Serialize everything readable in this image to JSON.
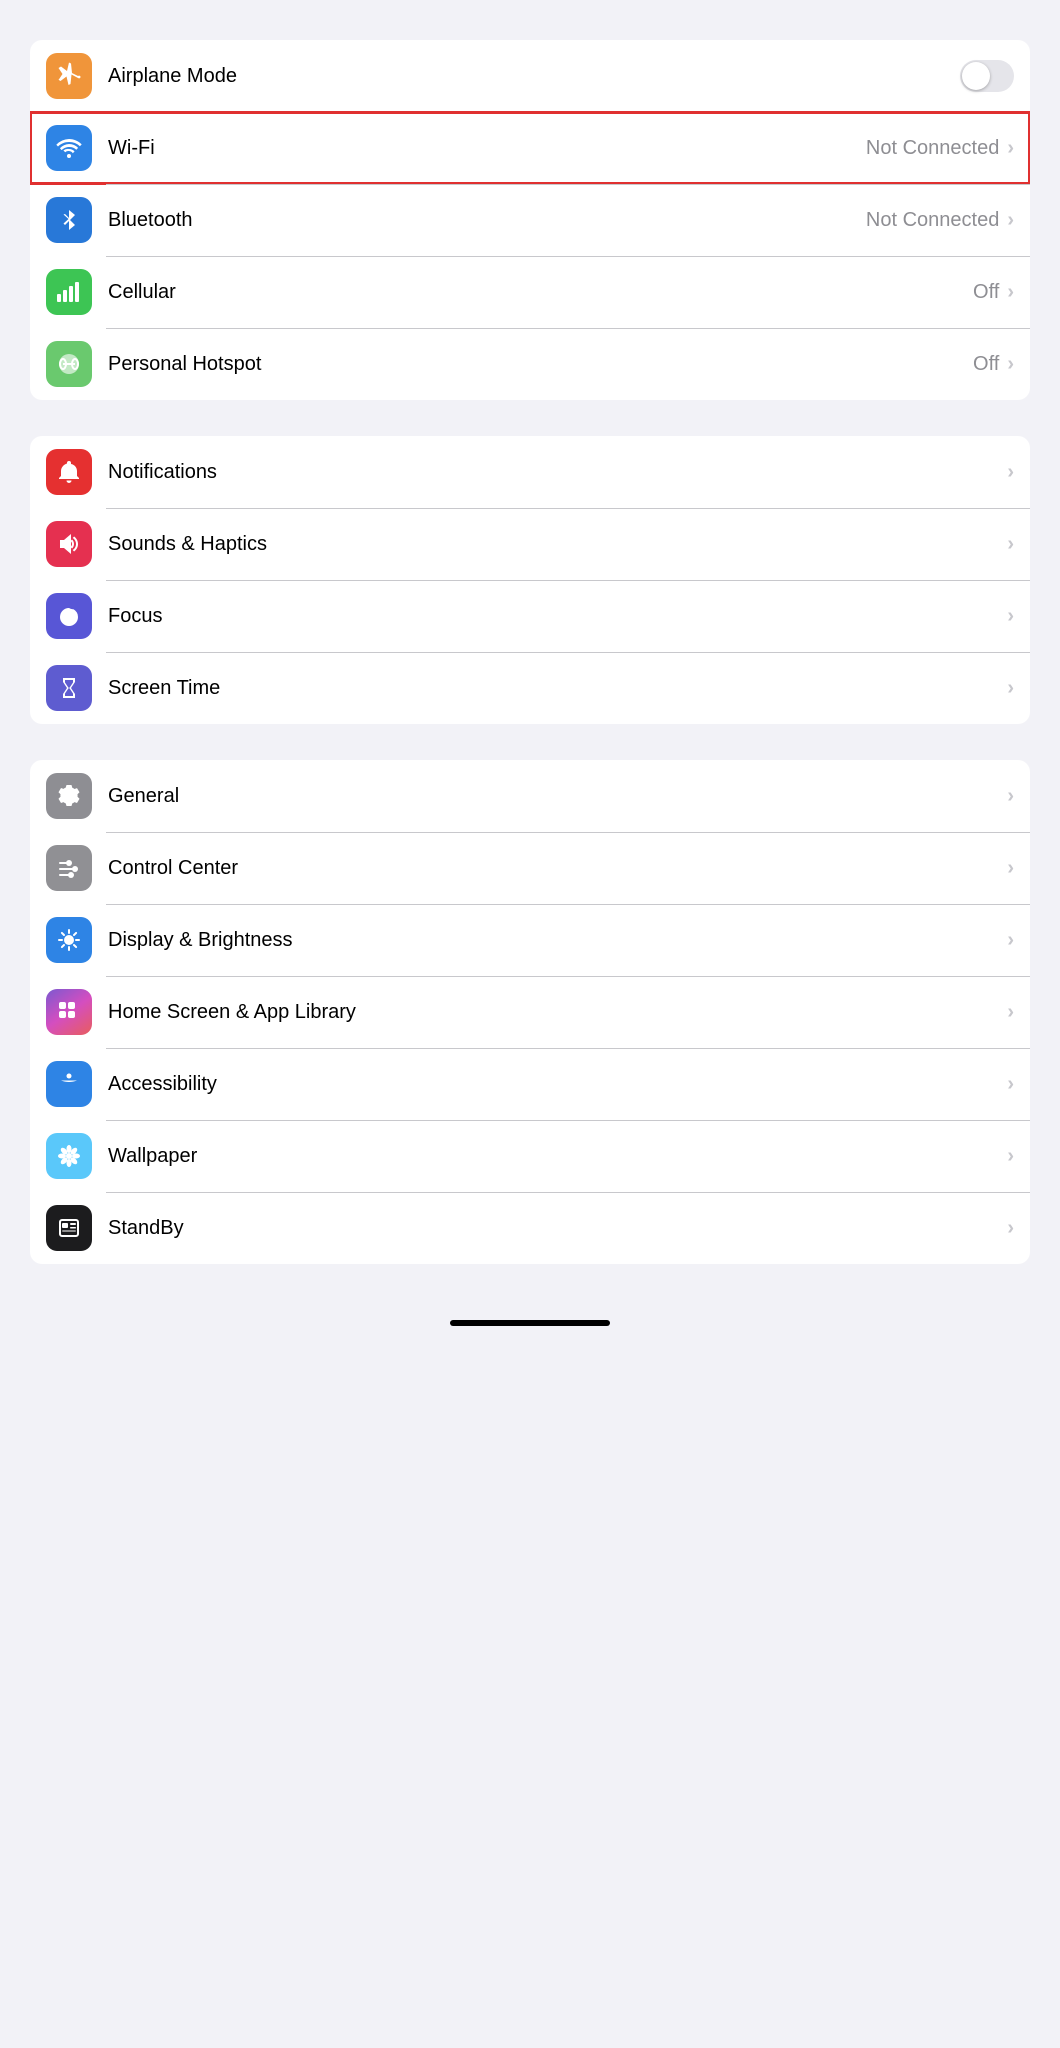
{
  "groups": [
    {
      "id": "connectivity",
      "rows": [
        {
          "id": "airplane-mode",
          "label": "Airplane Mode",
          "icon": "airplane-icon",
          "iconBg": "bg-orange",
          "type": "toggle",
          "toggleOn": false,
          "selected": false
        },
        {
          "id": "wifi",
          "label": "Wi-Fi",
          "icon": "wifi-icon",
          "iconBg": "bg-blue",
          "type": "value-chevron",
          "value": "Not Connected",
          "selected": true
        },
        {
          "id": "bluetooth",
          "label": "Bluetooth",
          "icon": "bluetooth-icon",
          "iconBg": "bg-blue-dark",
          "type": "value-chevron",
          "value": "Not Connected",
          "selected": false
        },
        {
          "id": "cellular",
          "label": "Cellular",
          "icon": "cellular-icon",
          "iconBg": "bg-green",
          "type": "value-chevron",
          "value": "Off",
          "selected": false
        },
        {
          "id": "personal-hotspot",
          "label": "Personal Hotspot",
          "icon": "hotspot-icon",
          "iconBg": "bg-green-light",
          "type": "value-chevron",
          "value": "Off",
          "selected": false
        }
      ]
    },
    {
      "id": "notifications",
      "rows": [
        {
          "id": "notifications",
          "label": "Notifications",
          "icon": "bell-icon",
          "iconBg": "bg-red",
          "type": "chevron",
          "selected": false
        },
        {
          "id": "sounds-haptics",
          "label": "Sounds & Haptics",
          "icon": "sound-icon",
          "iconBg": "bg-red-pink",
          "type": "chevron",
          "selected": false
        },
        {
          "id": "focus",
          "label": "Focus",
          "icon": "moon-icon",
          "iconBg": "bg-purple",
          "type": "chevron",
          "selected": false
        },
        {
          "id": "screen-time",
          "label": "Screen Time",
          "icon": "hourglass-icon",
          "iconBg": "bg-purple-dark",
          "type": "chevron",
          "selected": false
        }
      ]
    },
    {
      "id": "display",
      "rows": [
        {
          "id": "general",
          "label": "General",
          "icon": "gear-icon",
          "iconBg": "bg-gray",
          "type": "chevron",
          "selected": false
        },
        {
          "id": "control-center",
          "label": "Control Center",
          "icon": "sliders-icon",
          "iconBg": "bg-gray-med",
          "type": "chevron",
          "selected": false
        },
        {
          "id": "display-brightness",
          "label": "Display & Brightness",
          "icon": "sun-icon",
          "iconBg": "bg-blue",
          "type": "chevron",
          "selected": false
        },
        {
          "id": "home-screen",
          "label": "Home Screen & App Library",
          "icon": "homescreen-icon",
          "iconBg": "home-icon-wrap",
          "type": "chevron",
          "selected": false
        },
        {
          "id": "accessibility",
          "label": "Accessibility",
          "icon": "accessibility-icon",
          "iconBg": "bg-blue",
          "type": "chevron",
          "selected": false
        },
        {
          "id": "wallpaper",
          "label": "Wallpaper",
          "icon": "flower-icon",
          "iconBg": "wallpaper-icon-wrap",
          "type": "chevron",
          "selected": false
        },
        {
          "id": "standby",
          "label": "StandBy",
          "icon": "standby-icon",
          "iconBg": "bg-black",
          "type": "chevron",
          "selected": false
        }
      ]
    }
  ]
}
